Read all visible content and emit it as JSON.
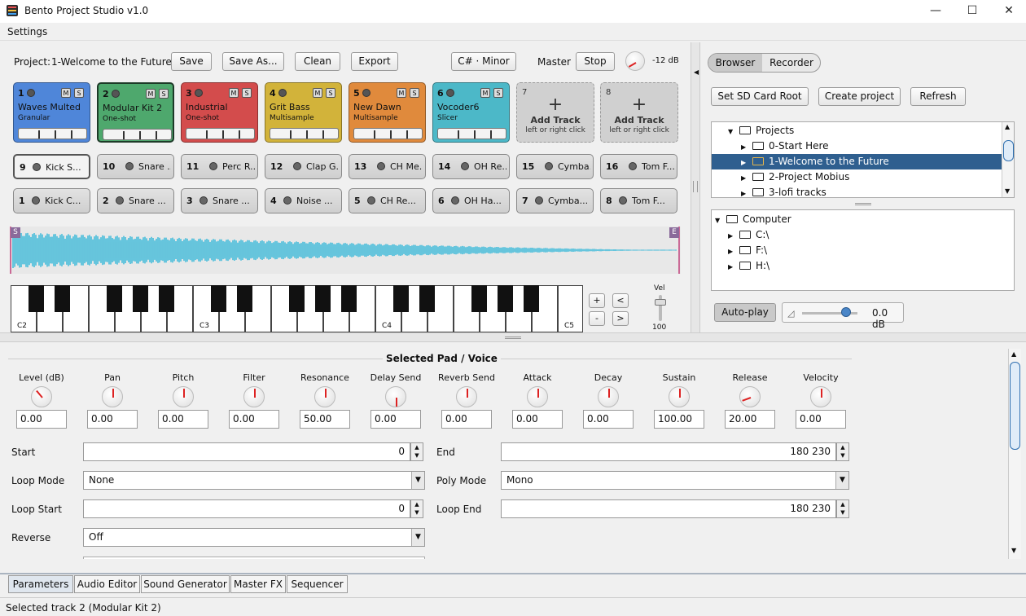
{
  "window": {
    "title": "Bento Project Studio v1.0"
  },
  "menu": {
    "settings": "Settings"
  },
  "toolbar": {
    "project_label": "Project:",
    "project_name": "1-Welcome to the Future",
    "save": "Save",
    "save_as": "Save As...",
    "clean": "Clean",
    "export": "Export",
    "key": "C# · Minor",
    "master_label": "Master",
    "stop": "Stop",
    "master_level": "-12 dB"
  },
  "tracks": [
    {
      "num": "1",
      "name": "Waves Multed",
      "type": "Granular",
      "color": "#4f86d9"
    },
    {
      "num": "2",
      "name": "Modular Kit 2",
      "type": "One-shot",
      "color": "#4ea86d"
    },
    {
      "num": "3",
      "name": "Industrial",
      "type": "One-shot",
      "color": "#d34c4c"
    },
    {
      "num": "4",
      "name": "Grit Bass",
      "type": "Multisample",
      "color": "#d2b33a"
    },
    {
      "num": "5",
      "name": "New Dawn",
      "type": "Multisample",
      "color": "#e08a3c"
    },
    {
      "num": "6",
      "name": "Vocoder6",
      "type": "Slicer",
      "color": "#4cb8c8"
    }
  ],
  "add_tracks": [
    {
      "num": "7",
      "title": "Add Track",
      "hint": "left or right click"
    },
    {
      "num": "8",
      "title": "Add Track",
      "hint": "left or right click"
    }
  ],
  "pads_row1": [
    {
      "num": "9",
      "name": "Kick S..."
    },
    {
      "num": "10",
      "name": "Snare ..."
    },
    {
      "num": "11",
      "name": "Perc R..."
    },
    {
      "num": "12",
      "name": "Clap G..."
    },
    {
      "num": "13",
      "name": "CH Me..."
    },
    {
      "num": "14",
      "name": "OH Re..."
    },
    {
      "num": "15",
      "name": "Cymba..."
    },
    {
      "num": "16",
      "name": "Tom F..."
    }
  ],
  "pads_row2": [
    {
      "num": "1",
      "name": "Kick C..."
    },
    {
      "num": "2",
      "name": "Snare ..."
    },
    {
      "num": "3",
      "name": "Snare ..."
    },
    {
      "num": "4",
      "name": "Noise ..."
    },
    {
      "num": "5",
      "name": "CH Re..."
    },
    {
      "num": "6",
      "name": "OH Ha..."
    },
    {
      "num": "7",
      "name": "Cymba..."
    },
    {
      "num": "8",
      "name": "Tom F..."
    }
  ],
  "waveform": {
    "start_marker": "S",
    "end_marker": "E",
    "color": "#2fb6d8"
  },
  "keyboard": {
    "octaves": [
      "C2",
      "C3",
      "C4",
      "C5"
    ],
    "plus": "+",
    "minus": "-",
    "left": "<",
    "right": ">",
    "vel_label": "Vel",
    "vel_value": "100"
  },
  "browser": {
    "tab_browser": "Browser",
    "tab_recorder": "Recorder",
    "set_sd": "Set SD Card Root",
    "create": "Create project",
    "refresh": "Refresh",
    "projects_root": "Projects",
    "projects": [
      "0-Start Here",
      "1-Welcome to the Future",
      "2-Project Mobius",
      "3-lofi tracks"
    ],
    "computer_root": "Computer",
    "drives": [
      "C:\\",
      "F:\\",
      "H:\\"
    ],
    "autoplay": "Auto-play",
    "volume": "0.0 dB"
  },
  "voice": {
    "title": "Selected Pad / Voice",
    "knobs": [
      {
        "label": "Level (dB)",
        "value": "0.00"
      },
      {
        "label": "Pan",
        "value": "0.00"
      },
      {
        "label": "Pitch",
        "value": "0.00"
      },
      {
        "label": "Filter",
        "value": "0.00"
      },
      {
        "label": "Resonance",
        "value": "50.00"
      },
      {
        "label": "Delay Send",
        "value": "0.00"
      },
      {
        "label": "Reverb Send",
        "value": "0.00"
      },
      {
        "label": "Attack",
        "value": "0.00"
      },
      {
        "label": "Decay",
        "value": "0.00"
      },
      {
        "label": "Sustain",
        "value": "100.00"
      },
      {
        "label": "Release",
        "value": "20.00"
      },
      {
        "label": "Velocity",
        "value": "0.00"
      }
    ],
    "start_label": "Start",
    "start_value": "0",
    "end_label": "End",
    "end_value": "180 230",
    "loop_mode_label": "Loop Mode",
    "loop_mode_value": "None",
    "poly_mode_label": "Poly Mode",
    "poly_mode_value": "Mono",
    "loop_start_label": "Loop Start",
    "loop_start_value": "0",
    "loop_end_label": "Loop End",
    "loop_end_value": "180 230",
    "reverse_label": "Reverse",
    "reverse_value": "Off"
  },
  "tabs": [
    "Parameters",
    "Audio Editor",
    "Sound Generator",
    "Master FX",
    "Sequencer"
  ],
  "status": "Selected track 2 (Modular Kit 2)"
}
